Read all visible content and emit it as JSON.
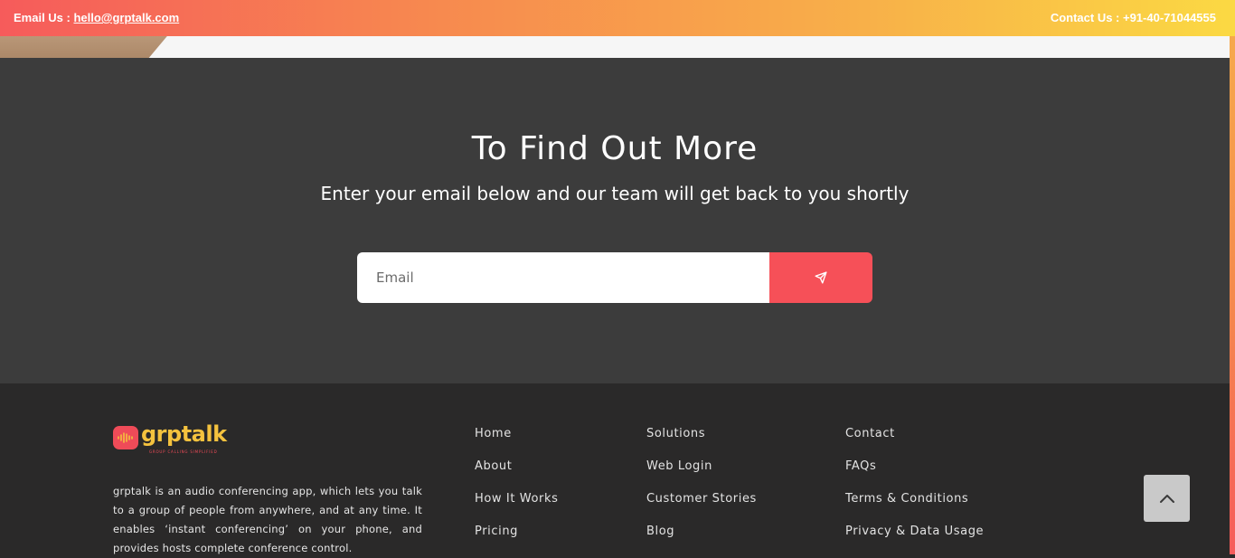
{
  "topbar": {
    "email_label": "Email Us : ",
    "email_link": "hello@grptalk.com",
    "contact_text": "Contact Us : +91-40-71044555"
  },
  "cta": {
    "title": "To Find Out More",
    "subtitle": "Enter your email below and our team will get back to you shortly",
    "email_placeholder": "Email",
    "send_icon": "paper-plane-icon",
    "button_color": "#f65058"
  },
  "footer": {
    "logo_text": "grptalk",
    "logo_tagline": "GROUP CALLING SIMPLIFIED",
    "about": "grptalk is an audio conferencing app, which lets you talk to a group of people from anywhere, and at any time. It enables ‘instant conferencing’ on your phone, and provides hosts complete conference control.",
    "columns": [
      [
        "Home",
        "About",
        "How It Works",
        "Pricing"
      ],
      [
        "Solutions",
        "Web Login",
        "Customer Stories",
        "Blog"
      ],
      [
        "Contact",
        "FAQs",
        "Terms & Conditions",
        "Privacy & Data Usage"
      ]
    ],
    "scroll_top_icon": "chevron-up-icon"
  },
  "colors": {
    "topbar_gradient_start": "#f65b5b",
    "topbar_gradient_end": "#fbd943",
    "cta_background": "#3c3c3c",
    "footer_background": "#2a2929",
    "logo_accent": "#f4c23e"
  }
}
